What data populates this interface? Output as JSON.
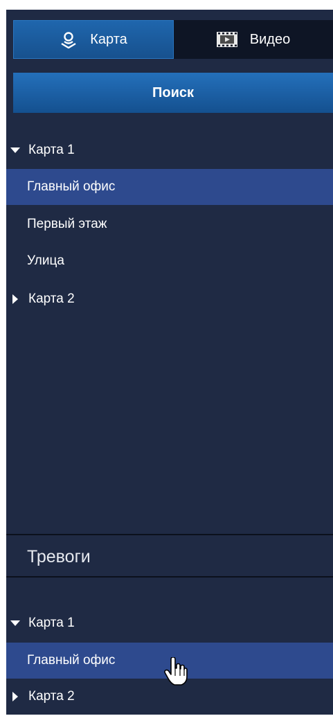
{
  "tabs": [
    {
      "label": "Карта",
      "icon": "map-pin-icon",
      "active": true
    },
    {
      "label": "Видео",
      "icon": "video-film-icon",
      "active": false
    }
  ],
  "search": {
    "label": "Поиск"
  },
  "maps_tree": [
    {
      "label": "Карта 1",
      "expanded": true
    },
    {
      "label": "Главный офис",
      "selected": true
    },
    {
      "label": "Первый этаж"
    },
    {
      "label": "Улица"
    },
    {
      "label": "Карта 2",
      "expanded": false
    }
  ],
  "alarms": {
    "title": "Тревоги",
    "tree": [
      {
        "label": "Карта 1",
        "expanded": true
      },
      {
        "label": "Главный офис",
        "selected": true
      },
      {
        "label": "Карта 2",
        "expanded": false
      }
    ]
  },
  "colors": {
    "panel_bg": "#1f2a44",
    "accent_blue": "#1f66ad",
    "selected_row": "#2e4a8e",
    "text": "#ffffff"
  }
}
